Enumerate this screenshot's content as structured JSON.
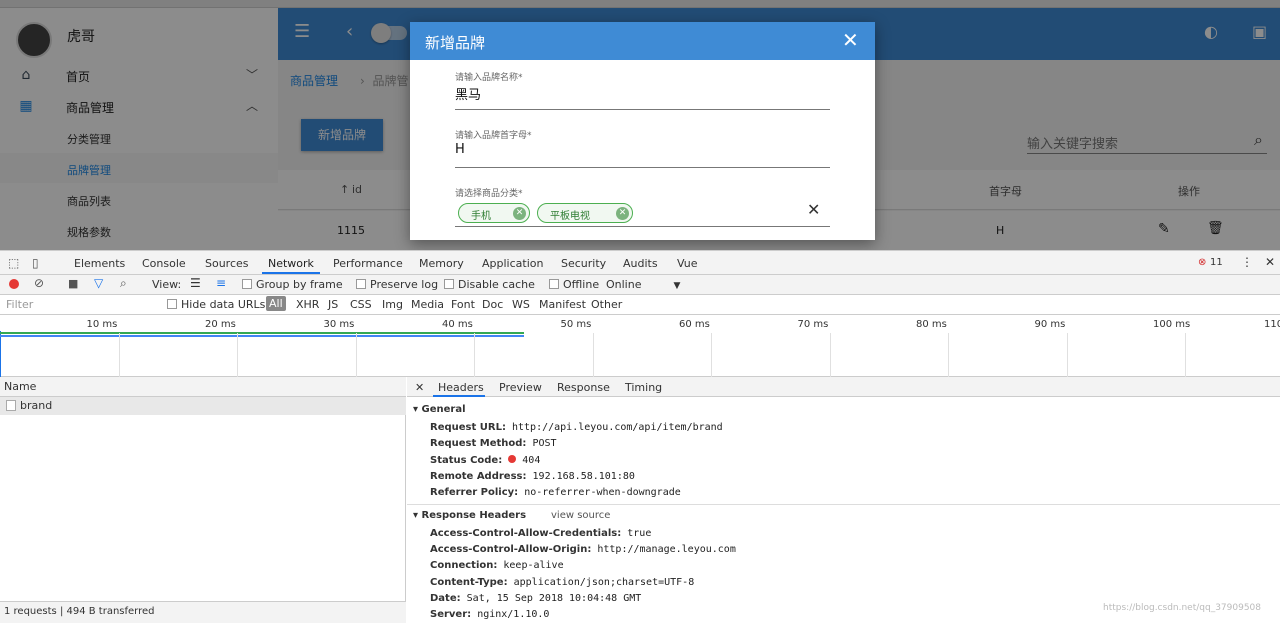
{
  "app": {
    "user": "虎哥",
    "nav": [
      {
        "label": "首页",
        "icon": "home-icon"
      },
      {
        "label": "商品管理",
        "icon": "grid-icon"
      }
    ],
    "sub_nav": [
      "分类管理",
      "品牌管理",
      "商品列表",
      "规格参数"
    ],
    "breadcrumb": [
      "商品管理",
      "品牌管"
    ],
    "add_button": "新增品牌",
    "search_placeholder": "输入关键字搜索",
    "table": {
      "headers": [
        "id",
        "首字母",
        "操作"
      ],
      "row": {
        "id": "1115",
        "letter": "H"
      }
    }
  },
  "dialog": {
    "title": "新增品牌",
    "fields": [
      {
        "label": "请输入品牌名称*",
        "value": "黑马"
      },
      {
        "label": "请输入品牌首字母*",
        "value": "H"
      }
    ],
    "category_label": "请选择商品分类*",
    "chips": [
      "手机",
      "平板电视"
    ]
  },
  "devtools": {
    "tabs": [
      "Elements",
      "Console",
      "Sources",
      "Network",
      "Performance",
      "Memory",
      "Application",
      "Security",
      "Audits",
      "Vue"
    ],
    "active_tab": "Network",
    "error_count": "11",
    "toolbar": {
      "view": "View:",
      "group_by_frame": "Group by frame",
      "preserve_log": "Preserve log",
      "disable_cache": "Disable cache",
      "offline": "Offline",
      "online": "Online"
    },
    "filter": {
      "placeholder": "Filter",
      "hide_data_urls": "Hide data URLs",
      "types": [
        "All",
        "XHR",
        "JS",
        "CSS",
        "Img",
        "Media",
        "Font",
        "Doc",
        "WS",
        "Manifest",
        "Other"
      ]
    },
    "timeline_ticks": [
      "10 ms",
      "20 ms",
      "30 ms",
      "40 ms",
      "50 ms",
      "60 ms",
      "70 ms",
      "80 ms",
      "90 ms",
      "100 ms",
      "110"
    ],
    "name_column": "Name",
    "requests": [
      "brand"
    ],
    "footer": "1 requests | 494 B transferred",
    "detail_tabs": [
      "Headers",
      "Preview",
      "Response",
      "Timing"
    ],
    "general": {
      "title": "General",
      "rows": [
        {
          "k": "Request URL:",
          "v": "http://api.leyou.com/api/item/brand"
        },
        {
          "k": "Request Method:",
          "v": "POST"
        },
        {
          "k": "Status Code:",
          "v": "404"
        },
        {
          "k": "Remote Address:",
          "v": "192.168.58.101:80"
        },
        {
          "k": "Referrer Policy:",
          "v": "no-referrer-when-downgrade"
        }
      ]
    },
    "response_headers": {
      "title": "Response Headers",
      "view_source": "view source",
      "rows": [
        {
          "k": "Access-Control-Allow-Credentials:",
          "v": "true"
        },
        {
          "k": "Access-Control-Allow-Origin:",
          "v": "http://manage.leyou.com"
        },
        {
          "k": "Connection:",
          "v": "keep-alive"
        },
        {
          "k": "Content-Type:",
          "v": "application/json;charset=UTF-8"
        },
        {
          "k": "Date:",
          "v": "Sat, 15 Sep 2018 10:04:48 GMT"
        },
        {
          "k": "Server:",
          "v": "nginx/1.10.0"
        }
      ]
    },
    "watermark": "https://blog.csdn.net/qq_37909508"
  }
}
